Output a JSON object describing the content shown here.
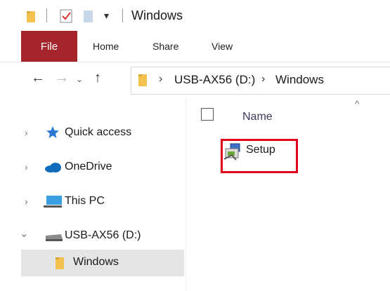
{
  "window": {
    "title": "Windows"
  },
  "ribbon": {
    "tabs": {
      "file": "File",
      "home": "Home",
      "share": "Share",
      "view": "View"
    }
  },
  "address": {
    "crumbs": [
      "USB-AX56 (D:)",
      "Windows"
    ]
  },
  "nav": {
    "items": {
      "quick_access": "Quick access",
      "onedrive": "OneDrive",
      "this_pc": "This PC",
      "usb": "USB-AX56 (D:)",
      "windows": "Windows"
    }
  },
  "content": {
    "column_name": "Name",
    "files": [
      {
        "name": "Setup",
        "icon": "setup-installer-icon"
      }
    ]
  },
  "colors": {
    "file_tab": "#a4262c",
    "highlight": "#e0001b",
    "folder": "#f2c14e",
    "selected_bg": "#e5e5e5"
  }
}
